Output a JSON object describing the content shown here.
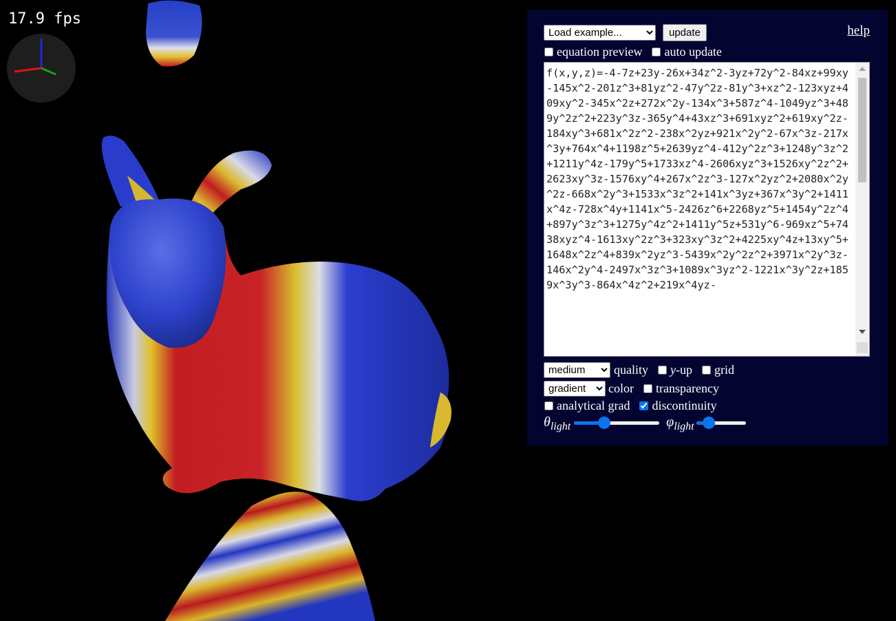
{
  "fps": "17.9 fps",
  "panel": {
    "example_select": {
      "value": "Load example...",
      "options": [
        "Load example..."
      ]
    },
    "update_button": "update",
    "help_link": "help",
    "equation_preview_label": "equation preview",
    "auto_update_label": "auto update",
    "equation": "f(x,y,z)=-4-7z+23y-26x+34z^2-3yz+72y^2-84xz+99xy-145x^2-201z^3+81yz^2-47y^2z-81y^3+xz^2-123xyz+409xy^2-345x^2z+272x^2y-134x^3+587z^4-1049yz^3+489y^2z^2+223y^3z-365y^4+43xz^3+691xyz^2+619xy^2z-184xy^3+681x^2z^2-238x^2yz+921x^2y^2-67x^3z-217x^3y+764x^4+1198z^5+2639yz^4-412y^2z^3+1248y^3z^2+1211y^4z-179y^5+1733xz^4-2606xyz^3+1526xy^2z^2+2623xy^3z-1576xy^4+267x^2z^3-127x^2yz^2+2080x^2y^2z-668x^2y^3+1533x^3z^2+141x^3yz+367x^3y^2+1411x^4z-728x^4y+1141x^5-2426z^6+2268yz^5+1454y^2z^4+897y^3z^3+1275y^4z^2+1411y^5z+531y^6-969xz^5+7438xyz^4-1613xy^2z^3+323xy^3z^2+4225xy^4z+13xy^5+1648x^2z^4+839x^2yz^3-5439x^2y^2z^2+3971x^2y^3z-146x^2y^4-2497x^3z^3+1089x^3yz^2-1221x^3y^2z+1859x^3y^3-864x^4z^2+219x^4yz-",
    "quality_select": "medium",
    "quality_label": "quality",
    "y_up_var": "y",
    "y_up_label": "-up",
    "grid_label": "grid",
    "color_select": "gradient",
    "color_label": "color",
    "transparency_label": "transparency",
    "analytical_grad_label": "analytical grad",
    "discontinuity_label": "discontinuity",
    "theta_symbol": "θ",
    "theta_sub": "light",
    "phi_symbol": "φ",
    "phi_sub": "light",
    "checked": {
      "equation_preview": false,
      "auto_update": false,
      "y_up": false,
      "grid": false,
      "transparency": false,
      "analytical_grad": false,
      "discontinuity": true
    },
    "theta_light": 0.35,
    "phi_light": 0.25,
    "accent_color": "#0b74ec",
    "panel_color": "#040431"
  }
}
